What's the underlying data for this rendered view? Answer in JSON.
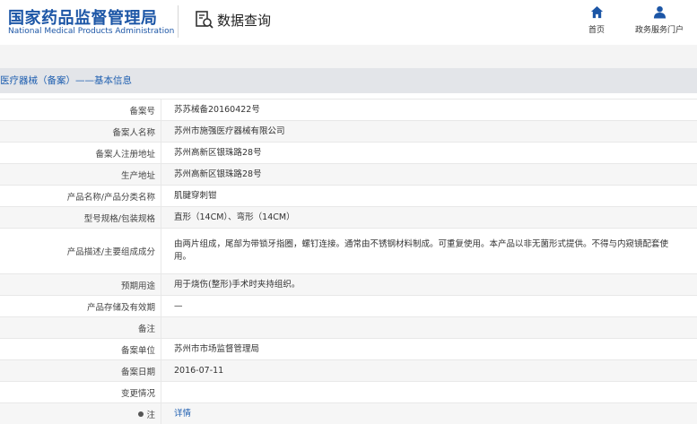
{
  "header": {
    "logo_cn": "国家药品监督管理局",
    "logo_en": "National Medical Products Administration",
    "query_label": "数据查询",
    "nav": {
      "home": "首页",
      "gov": "政务服务门户"
    }
  },
  "section": {
    "title": "医疗器械（备案）——基本信息"
  },
  "rows": [
    {
      "label": "备案号",
      "value": "苏苏械备20160422号"
    },
    {
      "label": "备案人名称",
      "value": "苏州市施强医疗器械有限公司"
    },
    {
      "label": "备案人注册地址",
      "value": "苏州高新区银珠路28号"
    },
    {
      "label": "生产地址",
      "value": "苏州高新区银珠路28号"
    },
    {
      "label": "产品名称/产品分类名称",
      "value": "肌腱穿刺钳"
    },
    {
      "label": "型号规格/包装规格",
      "value": "直形（14CM）、弯形（14CM）"
    },
    {
      "label": "产品描述/主要组成成分",
      "value": "由两片组成，尾部为带锁牙指圈，螺钉连接。通常由不锈钢材料制成。可重复使用。本产品以非无菌形式提供。不得与内窥镜配套使用。"
    },
    {
      "label": "预期用途",
      "value": "用于烧伤(整形)手术时夹持组织。"
    },
    {
      "label": "产品存储及有效期",
      "value": "—"
    },
    {
      "label": "备注",
      "value": ""
    },
    {
      "label": "备案单位",
      "value": "苏州市市场监督管理局"
    },
    {
      "label": "备案日期",
      "value": "2016-07-11"
    },
    {
      "label": "变更情况",
      "value": ""
    },
    {
      "label": "注",
      "value": "详情"
    }
  ],
  "colors": {
    "brand": "#1c56a6",
    "link": "#1f5fb0",
    "section_bg": "#e3e5e9"
  }
}
